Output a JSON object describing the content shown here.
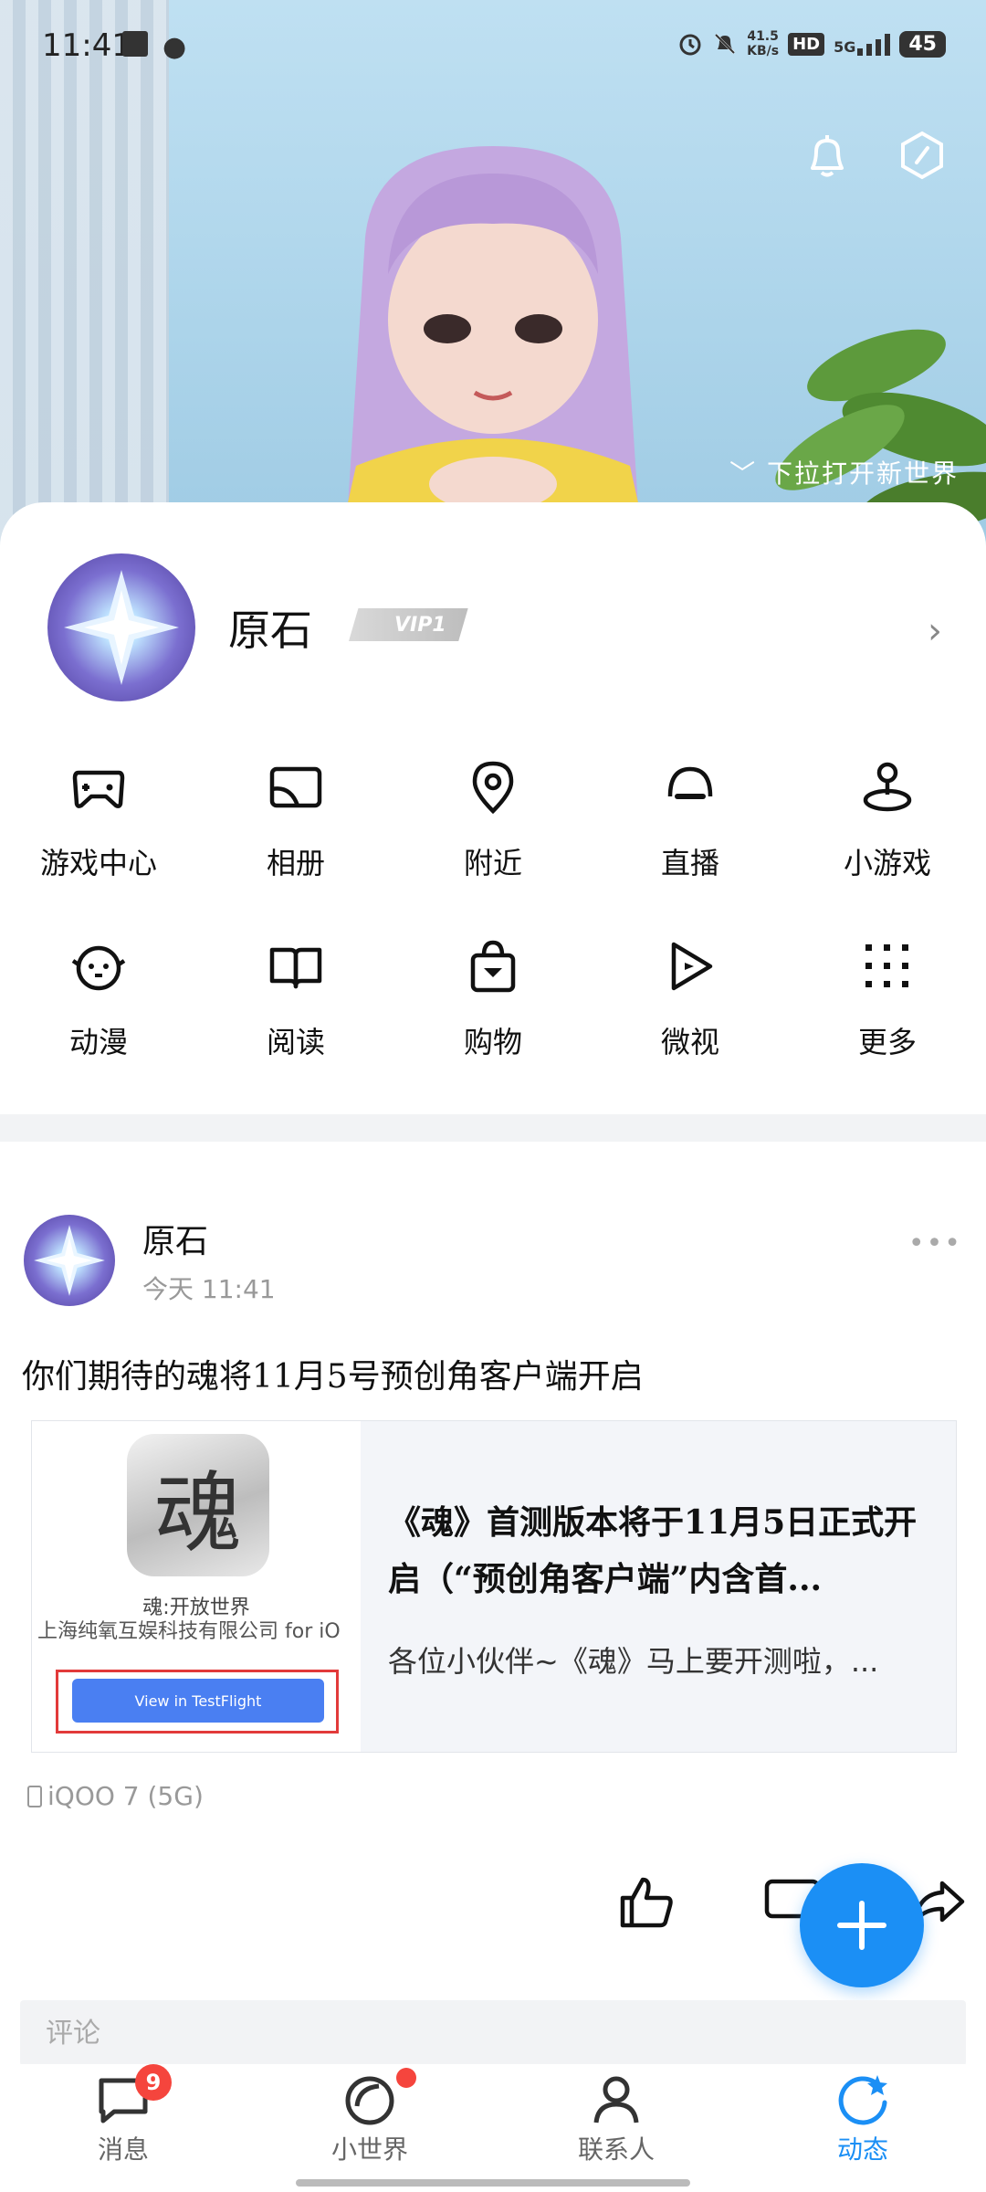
{
  "status_bar": {
    "time": "11:41",
    "net_speed_value": "41.5",
    "net_speed_unit": "KB/s",
    "hd": "HD",
    "signal": "5G",
    "battery": "45"
  },
  "banner": {
    "pull_hint": "下拉打开新世界"
  },
  "profile": {
    "name": "原石",
    "vip": "VIP1"
  },
  "grid": {
    "items": [
      {
        "label": "游戏中心",
        "icon": "gamepad-icon"
      },
      {
        "label": "相册",
        "icon": "album-icon"
      },
      {
        "label": "附近",
        "icon": "location-pin-icon"
      },
      {
        "label": "直播",
        "icon": "live-icon"
      },
      {
        "label": "小游戏",
        "icon": "joystick-icon"
      },
      {
        "label": "动漫",
        "icon": "anime-face-icon"
      },
      {
        "label": "阅读",
        "icon": "book-icon"
      },
      {
        "label": "购物",
        "icon": "shopping-bag-icon"
      },
      {
        "label": "微视",
        "icon": "play-icon"
      },
      {
        "label": "更多",
        "icon": "grid-dots-icon"
      }
    ]
  },
  "post": {
    "author": "原石",
    "time": "今天 11:41",
    "text": "你们期待的魂将11月5号预创角客户端开启",
    "link_card": {
      "title": "《魂》首测版本将于11月5日正式开启（“预创角客户端”内含首...",
      "description": "各位小伙伴~《魂》马上要开测啦，...",
      "thumb_app_name": "魂:开放世界",
      "thumb_company": "上海纯氧互娱科技有限公司 for iO",
      "thumb_button": "View in TestFlight",
      "thumb_icon_char": "魂"
    },
    "device": "iQOO 7 (5G)",
    "comment_placeholder": "评论"
  },
  "tabbar": {
    "tabs": [
      {
        "label": "消息",
        "badge": "9"
      },
      {
        "label": "小世界"
      },
      {
        "label": "联系人"
      },
      {
        "label": "动态"
      }
    ]
  },
  "colors": {
    "accent": "#1b8ff5",
    "badge": "#f5453d"
  }
}
